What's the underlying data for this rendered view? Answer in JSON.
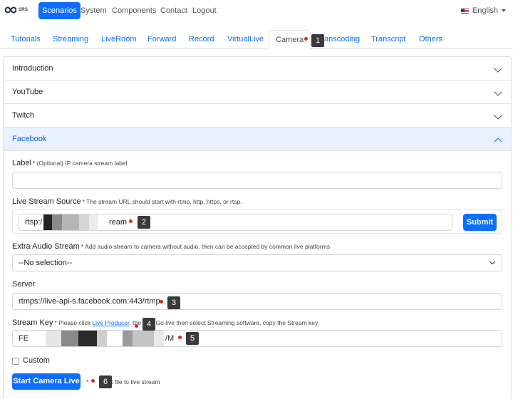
{
  "navbar": {
    "logo_text": "SRS",
    "items": [
      "Scenarios",
      "System",
      "Components",
      "Contact",
      "Logout"
    ],
    "language": "English"
  },
  "tabs": [
    "Tutorials",
    "Streaming",
    "LiveRoom",
    "Forward",
    "Record",
    "VirtualLive",
    "Camera",
    "Transcoding",
    "Transcript",
    "Others"
  ],
  "accordion": {
    "sections": [
      "Introduction",
      "YouTube",
      "Twitch",
      "Facebook"
    ]
  },
  "form": {
    "label": {
      "title": "Label",
      "hint": "* (Optional) IP camera stream label",
      "value": ""
    },
    "source": {
      "title": "Live Stream Source",
      "hint": "* The stream URL should start with rtmp, http, https, or rtsp.",
      "value_start": "rtsp:/",
      "value_end": "ream",
      "submit": "Submit"
    },
    "audio": {
      "title": "Extra Audio Stream",
      "hint": "* Add audio stream to camera without audio, then can be accepted by common live platforms",
      "selected": "--No selection--"
    },
    "server": {
      "title": "Server",
      "value": "rtmps://live-api-s.facebook.com:443/rtmp"
    },
    "key": {
      "title": "Stream Key",
      "hint_pre": "* Please click",
      "hint_link": "Live Producer",
      "hint_mid": ", the",
      "hint_post": "k Go live then select Streaming software, copy the Stream key",
      "value_start": "FE",
      "value_end": "/M"
    },
    "custom": "Custom",
    "start_button": "Start Camera Live",
    "start_hint_pre": "*",
    "start_hint_post": "t file to live stream"
  },
  "markers": [
    "1",
    "2",
    "3",
    "4",
    "5",
    "6"
  ],
  "colors": {
    "primary": "#0d6efd",
    "marker": "#3a3a3a",
    "dot": "#e02020"
  }
}
